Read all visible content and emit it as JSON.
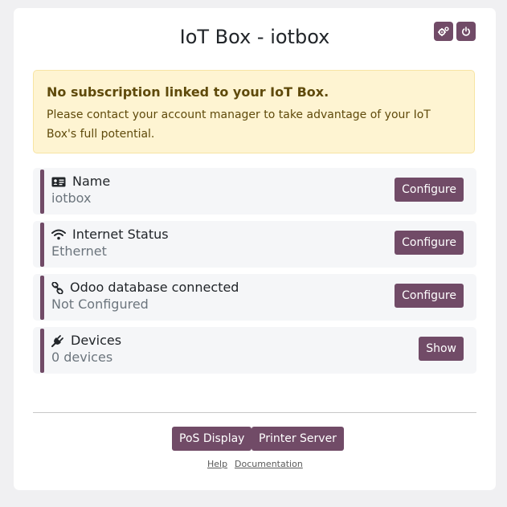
{
  "header": {
    "title": "IoT Box - iotbox",
    "settings_icon": "gears-icon",
    "power_icon": "power-icon"
  },
  "alert": {
    "title": "No subscription linked to your IoT Box.",
    "text": "Please contact your account manager to take advantage of your IoT Box's full potential."
  },
  "rows": [
    {
      "icon": "id-card-icon",
      "label": "Name",
      "value": "iotbox",
      "button": "Configure"
    },
    {
      "icon": "wifi-icon",
      "label": "Internet Status",
      "value": "Ethernet",
      "button": "Configure"
    },
    {
      "icon": "link-icon",
      "label": "Odoo database connected",
      "value": "Not Configured",
      "button": "Configure"
    },
    {
      "icon": "plug-icon",
      "label": "Devices",
      "value": "0 devices",
      "button": "Show"
    }
  ],
  "footer": {
    "pos_display": "PoS Display",
    "printer_server": "Printer Server",
    "help": "Help",
    "documentation": "Documentation"
  },
  "colors": {
    "accent": "#714b67",
    "alert_bg": "#fef4d2",
    "alert_text": "#5f4a0b",
    "row_bg": "#f5f6f8"
  }
}
